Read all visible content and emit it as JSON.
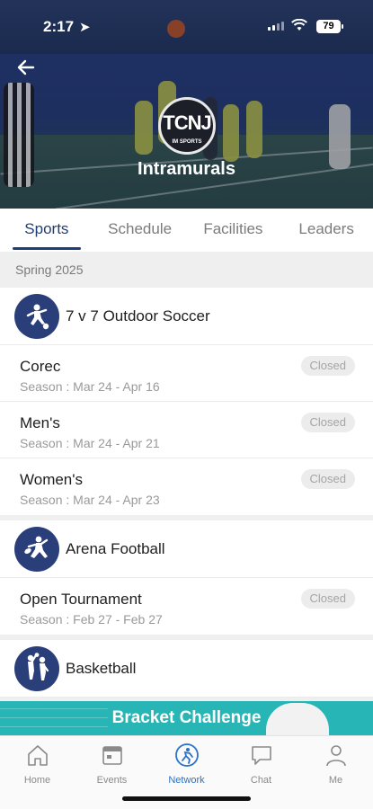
{
  "status": {
    "time": "2:17",
    "battery": "79"
  },
  "hero": {
    "title": "Intramurals",
    "logo_text": "TCNJ",
    "logo_subtext": "IM SPORTS"
  },
  "tabs": [
    {
      "label": "Sports",
      "active": true
    },
    {
      "label": "Schedule",
      "active": false
    },
    {
      "label": "Facilities",
      "active": false
    },
    {
      "label": "Leaders",
      "active": false
    }
  ],
  "season_header": "Spring 2025",
  "sports": [
    {
      "name": "7 v 7 Outdoor Soccer",
      "icon": "soccer-icon",
      "leagues": [
        {
          "name": "Corec",
          "season": "Season : Mar 24 - Apr 16",
          "status": "Closed"
        },
        {
          "name": "Men's",
          "season": "Season : Mar 24 - Apr 21",
          "status": "Closed"
        },
        {
          "name": "Women's",
          "season": "Season : Mar 24 - Apr 23",
          "status": "Closed"
        }
      ]
    },
    {
      "name": "Arena Football",
      "icon": "football-icon",
      "leagues": [
        {
          "name": "Open Tournament",
          "season": "Season : Feb 27 - Feb 27",
          "status": "Closed"
        }
      ]
    },
    {
      "name": "Basketball",
      "icon": "basketball-icon",
      "leagues": []
    }
  ],
  "banner": {
    "text": "Bracket Challenge"
  },
  "bottom_nav": [
    {
      "label": "Home",
      "icon": "home-icon",
      "active": false
    },
    {
      "label": "Events",
      "icon": "calendar-icon",
      "active": false
    },
    {
      "label": "Network",
      "icon": "network-icon",
      "active": true
    },
    {
      "label": "Chat",
      "icon": "chat-icon",
      "active": false
    },
    {
      "label": "Me",
      "icon": "person-icon",
      "active": false
    }
  ],
  "colors": {
    "primary": "#1e3e7a",
    "accent": "#2a72c8",
    "banner": "#27b5b5"
  }
}
